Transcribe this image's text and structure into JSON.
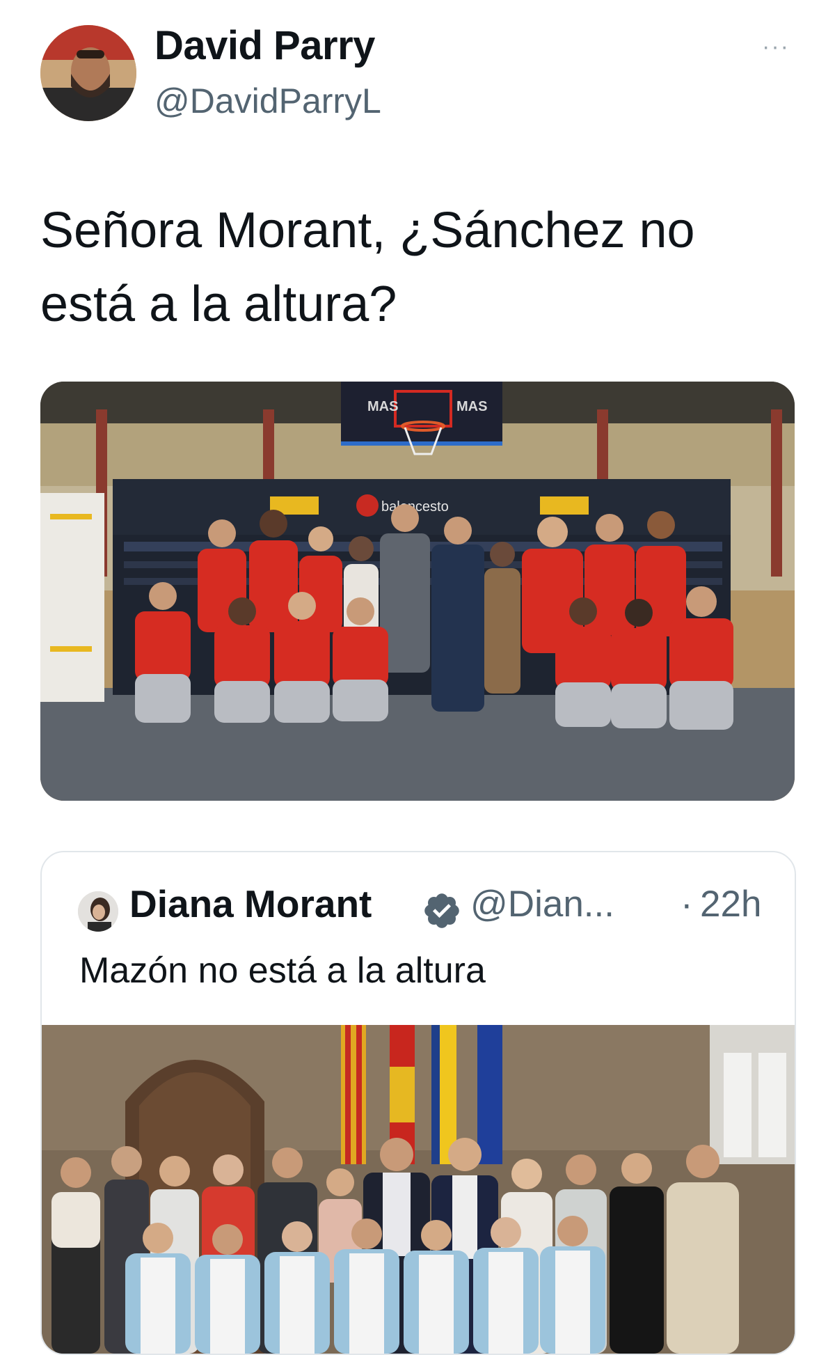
{
  "tweet": {
    "author": {
      "display_name": "David Parry",
      "handle": "@DavidParryL",
      "avatar_icon": "profile-photo"
    },
    "more_icon": "more-horizontal-icon",
    "more_glyph": "···",
    "text": "Señora Morant, ¿Sánchez no está a la altura?",
    "photo": {
      "signage": [
        "MAS",
        "MAS",
        "baloncesto"
      ]
    }
  },
  "quoted_tweet": {
    "author": {
      "display_name": "Diana Morant",
      "handle": "@Dian...",
      "verified": true,
      "verified_icon": "verified-badge-icon"
    },
    "separator": "·",
    "time": "22h",
    "text": "Mazón no está a la altura"
  },
  "colors": {
    "text_primary": "#0f1419",
    "text_secondary": "#536471",
    "verified_badge": "#536471",
    "jersey_red": "#d62c22",
    "border": "#e1e6ea"
  }
}
